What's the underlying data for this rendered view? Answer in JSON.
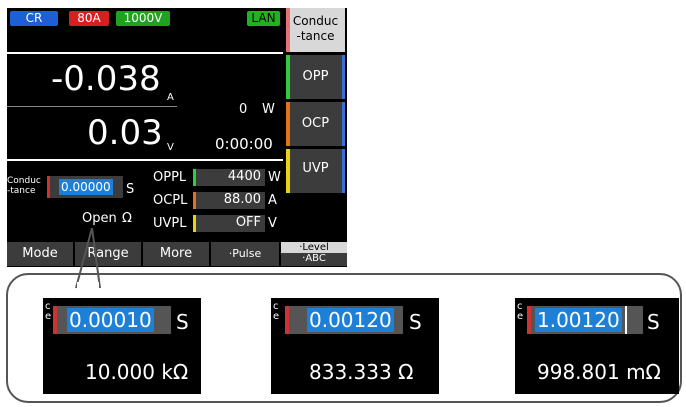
{
  "status_badges": {
    "mode": "CR",
    "current_range": "80A",
    "voltage_range": "1000V",
    "lan": "LAN"
  },
  "readings": {
    "current_value": "-0.038",
    "current_unit": "A",
    "voltage_value": "0.03",
    "voltage_unit": "V",
    "power_value": "0",
    "power_unit": "W",
    "elapsed_time": "0:00:00"
  },
  "conductance": {
    "label_line1": "Conduc",
    "label_line2": "-tance",
    "value": "0.00000",
    "unit": "S",
    "resistance_text": "Open",
    "resistance_unit": "Ω"
  },
  "protection": {
    "oppl": {
      "label": "OPPL",
      "value": "4400",
      "unit": "W",
      "color": "#2ecc40"
    },
    "ocpl": {
      "label": "OCPL",
      "value": "88.00",
      "unit": "A",
      "color": "#e8701a"
    },
    "uvpl": {
      "label": "UVPL",
      "value": "OFF",
      "unit": "V",
      "color": "#e6d31a"
    }
  },
  "side_buttons": {
    "conductance_line1": "Conduc",
    "conductance_line2": "-tance",
    "opp": "OPP",
    "ocp": "OCP",
    "uvp": "UVP"
  },
  "bottom_buttons": {
    "mode": "Mode",
    "range": "Range",
    "more": "More",
    "pulse": "·Pulse",
    "level": "·Level",
    "abc": "·ABC"
  },
  "zoom_examples": [
    {
      "value": "0.00010",
      "unit": "S",
      "resistance": "10.000 kΩ"
    },
    {
      "value": "0.00120",
      "unit": "S",
      "resistance": "833.333  Ω"
    },
    {
      "value": "1.00120",
      "unit": "S",
      "resistance": "998.801 mΩ"
    }
  ],
  "colors": {
    "cr_badge": "#1d5fd6",
    "range_badge": "#d61f1f",
    "voltage_badge": "#1fa31f",
    "lan_badge": "#1fb41f",
    "selected_value": "#1d7fd6"
  }
}
